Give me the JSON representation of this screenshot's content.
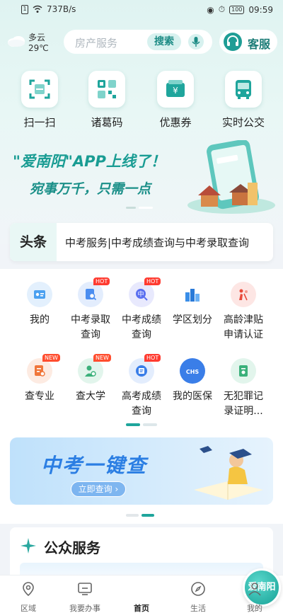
{
  "status_bar": {
    "speed": "737B/s",
    "battery": "100",
    "time": "09:59"
  },
  "header": {
    "weather": {
      "desc": "多云",
      "temp": "29℃"
    },
    "search": {
      "placeholder": "房产服务",
      "button": "搜索"
    },
    "service_label": "客服"
  },
  "quick_tools": [
    {
      "label": "扫一扫",
      "icon": "scan-icon"
    },
    {
      "label": "诸葛码",
      "icon": "qr-code-icon"
    },
    {
      "label": "优惠券",
      "icon": "coupon-icon"
    },
    {
      "label": "实时公交",
      "icon": "bus-icon"
    }
  ],
  "hero": {
    "title": "\"爱南阳\"APP上线了！",
    "subtitle": "宛事万千，只需一点",
    "slide_count": 2,
    "active_slide": 2
  },
  "headline": {
    "tag": "头条",
    "text": "中考服务|中考成绩查询与中考录取查询"
  },
  "services": [
    {
      "label": "我的",
      "icon": "id-card-icon",
      "badge": "",
      "color": "#4aa0f0"
    },
    {
      "label": "中考录取查询",
      "icon": "admission-search-icon",
      "badge": "HOT",
      "color": "#4a8df0"
    },
    {
      "label": "中考成绩查询",
      "icon": "score-search-icon",
      "badge": "HOT",
      "color": "#5a6ff0"
    },
    {
      "label": "学区划分",
      "icon": "school-district-icon",
      "badge": "",
      "color": "#3a8ee8"
    },
    {
      "label": "高龄津贴申请认证",
      "icon": "elderly-allowance-icon",
      "badge": "",
      "color": "#e84a3a"
    },
    {
      "label": "查专业",
      "icon": "major-search-icon",
      "badge": "NEW",
      "color": "#f0763a"
    },
    {
      "label": "查大学",
      "icon": "university-search-icon",
      "badge": "NEW",
      "color": "#3ab07a"
    },
    {
      "label": "高考成绩查询",
      "icon": "gaokao-score-icon",
      "badge": "HOT",
      "color": "#3a7ee8"
    },
    {
      "label": "我的医保",
      "icon": "medical-insurance-icon",
      "badge": "",
      "color": "#3a7ee8"
    },
    {
      "label": "无犯罪记录证明...",
      "icon": "no-crime-record-icon",
      "badge": "",
      "color": "#3ab07a"
    }
  ],
  "grid_pages": {
    "count": 2,
    "active": 1
  },
  "promo": {
    "title": "中考一键查",
    "button": "立即查询",
    "slide_count": 2,
    "active_slide": 2
  },
  "public_services": {
    "title": "公众服务"
  },
  "bottom_nav": [
    {
      "label": "区域",
      "icon": "location-icon",
      "active": false
    },
    {
      "label": "我要办事",
      "icon": "monitor-icon",
      "active": false
    },
    {
      "label": "首页",
      "icon": "home-logo-icon",
      "active": true
    },
    {
      "label": "生活",
      "icon": "compass-icon",
      "active": false
    },
    {
      "label": "我的",
      "icon": "user-icon",
      "active": false
    }
  ],
  "center_logo_text": "爱南阳",
  "colors": {
    "primary": "#1fa59c",
    "hot_badge": "#ff3b30",
    "promo_blue": "#2b7ee3"
  }
}
